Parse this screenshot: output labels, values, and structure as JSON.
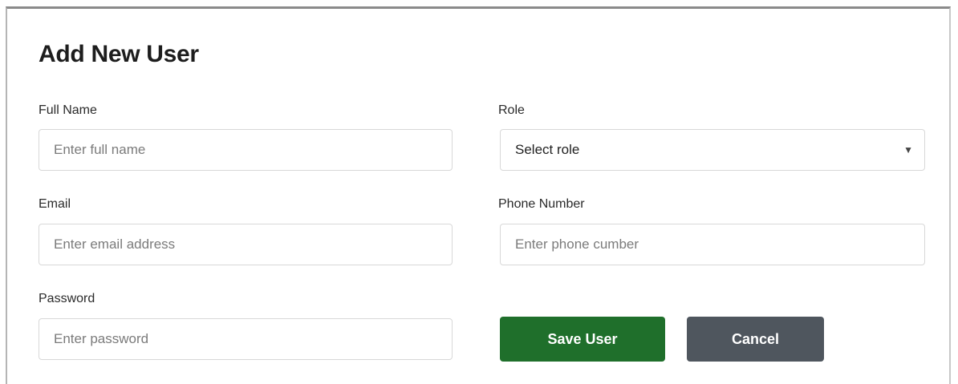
{
  "form": {
    "title": "Add New User",
    "full_name": {
      "label": "Full Name",
      "placeholder": "Enter full name",
      "value": ""
    },
    "role": {
      "label": "Role",
      "selected": "Select role"
    },
    "email": {
      "label": "Email",
      "placeholder": "Enter email address",
      "value": ""
    },
    "phone": {
      "label": "Phone Number",
      "placeholder": "Enter phone cumber",
      "value": ""
    },
    "password": {
      "label": "Password",
      "placeholder": "Enter password",
      "value": ""
    },
    "save_label": "Save User",
    "cancel_label": "Cancel"
  },
  "colors": {
    "save_button": "#1f6f2b",
    "cancel_button": "#4f565e"
  },
  "icons": {
    "role_dropdown": "chevron-down-icon"
  }
}
